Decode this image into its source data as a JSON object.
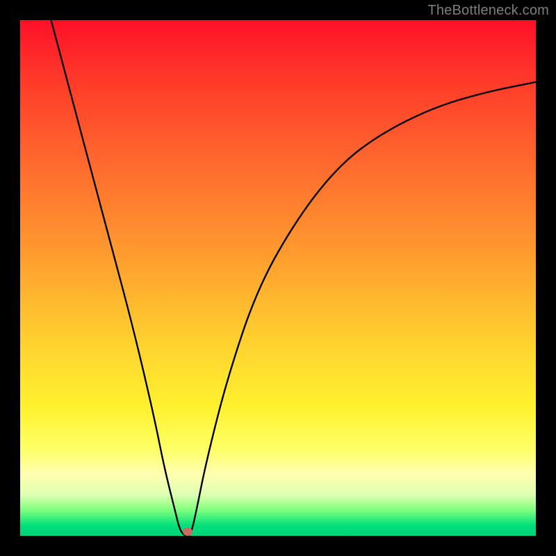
{
  "watermark": "TheBottleneck.com",
  "colors": {
    "frame": "#000000",
    "curve": "#000000",
    "watermark_text": "#7f7f7f",
    "marker": "#cc6b5f",
    "gradient_top": "#ff1028",
    "gradient_bottom": "#00d07a"
  },
  "chart_data": {
    "type": "line",
    "title": "",
    "xlabel": "",
    "ylabel": "",
    "xlim": [
      0,
      100
    ],
    "ylim": [
      0,
      100
    ],
    "grid": false,
    "series": [
      {
        "name": "bottleneck-curve",
        "x": [
          6,
          10,
          14,
          18,
          22,
          26,
          28,
          30,
          31,
          32,
          33,
          34,
          36,
          40,
          46,
          54,
          62,
          70,
          80,
          90,
          100
        ],
        "y": [
          100,
          85,
          70,
          55,
          40,
          23,
          13,
          5,
          1,
          0,
          0,
          4,
          14,
          30,
          48,
          62,
          72,
          78,
          83,
          86,
          88
        ]
      }
    ],
    "annotations": [
      {
        "name": "min-point-marker",
        "x": 32.5,
        "y": 0.8
      }
    ]
  }
}
